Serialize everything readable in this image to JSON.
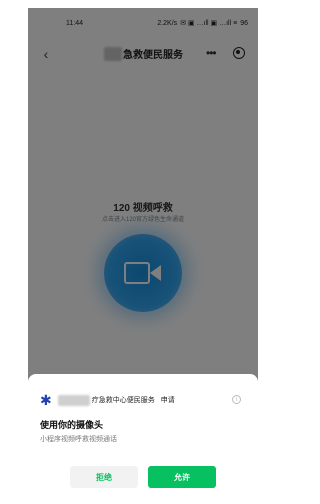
{
  "status_bar": {
    "time": "11:44",
    "network_speed": "2.2K/s",
    "icons_text": "✉ ▣ …ıll ▣ …ıll ≡",
    "battery": "96"
  },
  "nav": {
    "back_icon": "back-arrow-icon",
    "title": "急救便民服务",
    "more_label": "•••",
    "target_icon": "target-icon"
  },
  "main": {
    "call_title": "120 视频呼救",
    "call_subtitle": "点击进入120官方绿色生命通道",
    "video_icon": "video-camera-icon"
  },
  "sheet": {
    "app_name": "疗急救中心便民服务",
    "request_label": "申请",
    "permission_title": "使用你的摄像头",
    "permission_desc": "小程序视频呼救视频通话",
    "deny_label": "拒绝",
    "allow_label": "允许",
    "info_icon": "info-icon"
  },
  "colors": {
    "accent_green": "#07c160",
    "video_blue": "#1a8fe0",
    "logo_blue": "#2340b0"
  }
}
